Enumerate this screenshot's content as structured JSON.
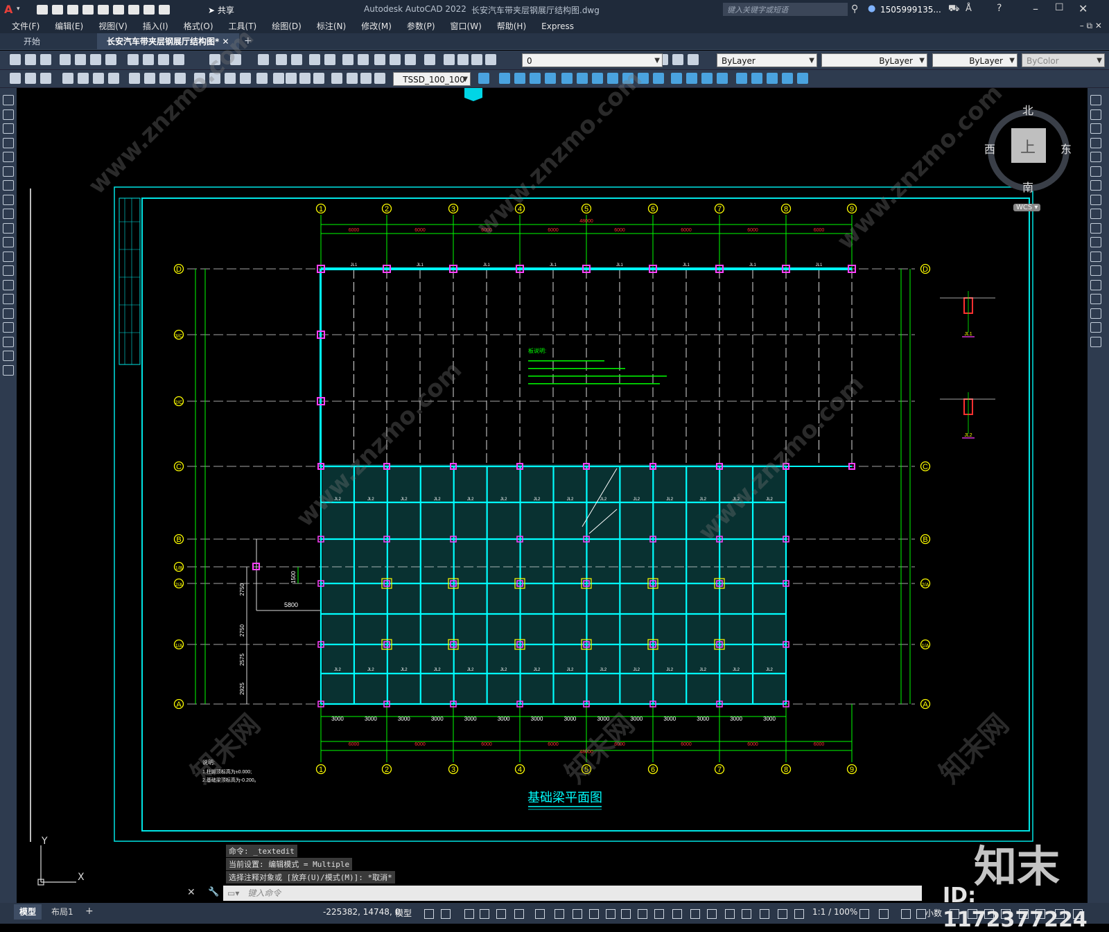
{
  "app": {
    "logo": "A",
    "title": "Autodesk AutoCAD 2022",
    "filename": "长安汽车带夹层钢展厅结构图.dwg",
    "share_label": "共享",
    "search_placeholder": "键入关键字或短语",
    "user": "1505999135...",
    "window_controls": [
      "minimize-icon",
      "maximize-icon",
      "close-icon"
    ]
  },
  "menu": [
    "文件(F)",
    "编辑(E)",
    "视图(V)",
    "插入(I)",
    "格式(O)",
    "工具(T)",
    "绘图(D)",
    "标注(N)",
    "修改(M)",
    "参数(P)",
    "窗口(W)",
    "帮助(H)",
    "Express"
  ],
  "tabs": [
    {
      "label": "开始"
    },
    {
      "label": "长安汽车带夹层钢展厅结构图*"
    }
  ],
  "toolbar": {
    "layer": "0",
    "color": "ByLayer",
    "linetype": "ByLayer",
    "lineweight": "ByLayer",
    "plotstyle": "ByColor",
    "dimstyle": "TSSD_100_100"
  },
  "viewcube": {
    "north": "北",
    "south": "南",
    "east": "东",
    "west": "西",
    "top": "上",
    "wcs": "WCS"
  },
  "drawing": {
    "title": "基础梁平面图",
    "axis_numbers": [
      "1",
      "2",
      "3",
      "4",
      "5",
      "6",
      "7",
      "8",
      "9"
    ],
    "axis_letters_left": [
      "D",
      "3/C",
      "2/C",
      "C",
      "B",
      "1/B",
      "2/A",
      "1/A",
      "A"
    ],
    "axis_letters_right": [
      "D",
      "C",
      "B",
      "2/A",
      "1/A",
      "A"
    ],
    "top_bay_dims": [
      "6000",
      "6000",
      "6000",
      "6000",
      "6000",
      "6000",
      "6000",
      "6000"
    ],
    "top_total": "48000",
    "bottom_sub_dims": [
      "3000",
      "3000",
      "3000",
      "3000",
      "3000",
      "3000",
      "3000",
      "3000",
      "3000",
      "3000",
      "3000",
      "3000",
      "3000",
      "3000"
    ],
    "bottom_bay_dims": [
      "6000",
      "6000",
      "6000",
      "6000",
      "6000",
      "6000",
      "6000",
      "6000"
    ],
    "bottom_total": "48000",
    "left_dims": [
      "2750",
      "2750",
      "2575",
      "2925"
    ],
    "dim_5800": "5800",
    "dim_1500": "1500",
    "beam_labels": [
      "JL1",
      "JL2"
    ],
    "section_labels": [
      "JL1",
      "JL2"
    ],
    "notes_title": "说明:",
    "notes": [
      "1.柱脚顶标高为±0.000;",
      "2.基础梁顶标高为-0.200。"
    ],
    "plate_notes_title": "板说明:"
  },
  "command": {
    "history": [
      "命令: _textedit",
      "当前设置: 编辑模式 = Multiple",
      "选择注释对象或 [放弃(U)/模式(M)]: *取消*"
    ],
    "placeholder": "键入命令"
  },
  "status": {
    "model_tab": "模型",
    "layout_tab": "布局1",
    "coords": "-225382, 14748, 0",
    "space": "模型",
    "scale": "1:1 / 100%",
    "units": "小数"
  },
  "watermark": {
    "brand": "知末",
    "id_text": "ID: 1172377224",
    "site": "www.znzmo.com",
    "cn_site": "知末网"
  },
  "colors": {
    "title_bg": "#1f2a3a",
    "frame": "#00e5e5",
    "grid_green": "#00ff00",
    "beam_cyan": "#00ffff",
    "column_magenta": "#ff40ff",
    "dim_red": "#ff3030",
    "axis_yellow": "#ffff00"
  }
}
